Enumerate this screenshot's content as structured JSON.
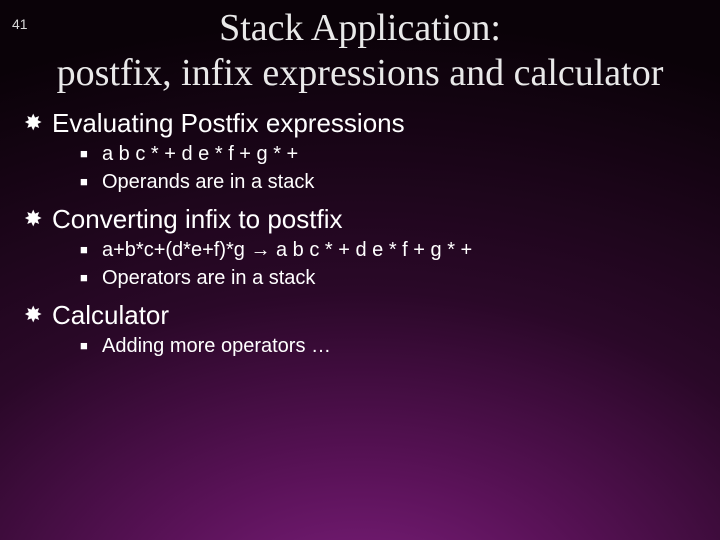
{
  "slide_number": "41",
  "title": "Stack Application:\npostfix, infix expressions and calculator",
  "sections": [
    {
      "heading": "Evaluating Postfix expressions",
      "items": [
        "a b c * + d e * f + g * +",
        "Operands are in a stack"
      ]
    },
    {
      "heading": "Converting infix to postfix",
      "items": [
        "a+b*c+(d*e+f)*g → a b c * + d e * f + g * +",
        "Operators are in a stack"
      ]
    },
    {
      "heading": "Calculator",
      "items": [
        "Adding more operators …"
      ]
    }
  ]
}
